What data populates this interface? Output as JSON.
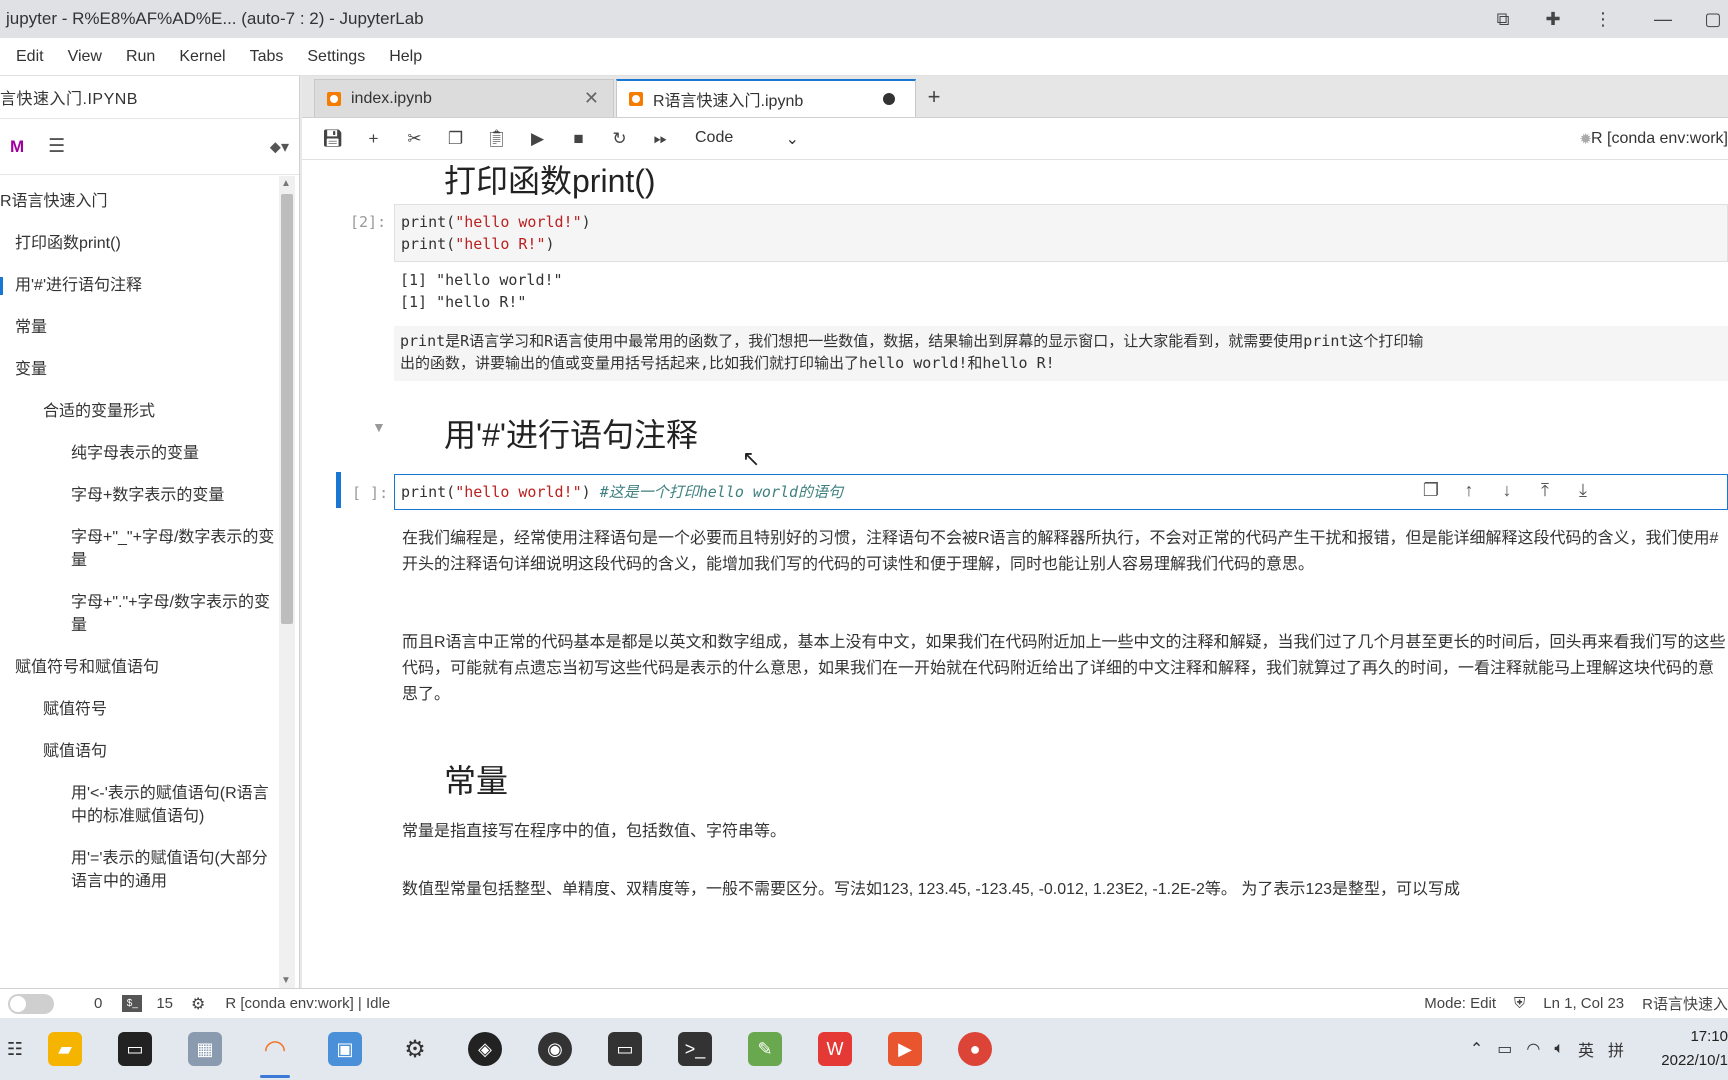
{
  "window": {
    "title": "jupyter - R%E8%AF%AD%E... (auto-7 : 2) - JupyterLab"
  },
  "menu": [
    "Edit",
    "View",
    "Run",
    "Kernel",
    "Tabs",
    "Settings",
    "Help"
  ],
  "sidebar": {
    "header": "言快速入门.IPYNB",
    "toc": [
      {
        "label": "R语言快速入门",
        "level": 1
      },
      {
        "label": "打印函数print()",
        "level": 2
      },
      {
        "label": "用'#'进行语句注释",
        "level": 2,
        "active": true
      },
      {
        "label": "常量",
        "level": 2
      },
      {
        "label": "变量",
        "level": 2
      },
      {
        "label": "合适的变量形式",
        "level": 3
      },
      {
        "label": "纯字母表示的变量",
        "level": 4
      },
      {
        "label": "字母+数字表示的变量",
        "level": 4
      },
      {
        "label": "字母+\"_\"+字母/数字表示的变量",
        "level": 4
      },
      {
        "label": "字母+\".\"+字母/数字表示的变量",
        "level": 4
      },
      {
        "label": "赋值符号和赋值语句",
        "level": 2
      },
      {
        "label": "赋值符号",
        "level": 3
      },
      {
        "label": "赋值语句",
        "level": 3
      },
      {
        "label": "用'<-'表示的赋值语句(R语言中的标准赋值语句)",
        "level": 4
      },
      {
        "label": "用'='表示的赋值语句(大部分语言中的通用",
        "level": 4
      }
    ]
  },
  "tabs": [
    {
      "label": "index.ipynb",
      "active": false
    },
    {
      "label": "R语言快速入门.ipynb",
      "active": true
    }
  ],
  "toolbar": {
    "cell_type": "Code",
    "kernel": "R [conda env:work]"
  },
  "notebook": {
    "heading1": "打印函数print()",
    "cell1_prompt": "[2]:",
    "cell1_line1_fn": "print(",
    "cell1_line1_str": "\"hello world!\"",
    "cell1_line2_str": "\"hello R!\"",
    "cell1_close": ")",
    "output1_line1": "[1] \"hello world!\"",
    "output1_line2": "[1] \"hello R!\"",
    "md1_line1": "print是R语言学习和R语言使用中最常用的函数了，我们想把一些数值，数据，结果输出到屏幕的显示窗口，让大家能看到，就需要使用print这个打印输",
    "md1_line2": "出的函数，讲要输出的值或变量用括号括起来,比如我们就打印输出了hello world!和hello R!",
    "heading2": "用'#'进行语句注释",
    "cell2_prompt": "[ ]:",
    "cell2_fn": "print(",
    "cell2_str": "\"hello world!\"",
    "cell2_close": ") ",
    "cell2_comment": "#这是一个打印hello world的语句",
    "para1": "在我们编程是，经常使用注释语句是一个必要而且特别好的习惯，注释语句不会被R语言的解释器所执行，不会对正常的代码产生干扰和报错，但是能详细解释这段代码的含义，我们使用#开头的注释语句详细说明这段代码的含义，能增加我们写的代码的可读性和便于理解，同时也能让别人容易理解我们代码的意思。",
    "para2": "而且R语言中正常的代码基本是都是以英文和数字组成，基本上没有中文，如果我们在代码附近加上一些中文的注释和解疑，当我们过了几个月甚至更长的时间后，回头再来看我们写的这些代码，可能就有点遗忘当初写这些代码是表示的什么意思，如果我们在一开始就在代码附近给出了详细的中文注释和解释，我们就算过了再久的时间，一看注释就能马上理解这块代码的意思了。",
    "heading3": "常量",
    "para3": "常量是指直接写在程序中的值，包括数值、字符串等。",
    "para4": "数值型常量包括整型、单精度、双精度等，一般不需要区分。写法如123, 123.45, -123.45, -0.012, 1.23E2, -1.2E-2等。 为了表示123是整型，可以写成"
  },
  "status": {
    "count1": "0",
    "count2": "15",
    "kernel_status": "R [conda env:work] | Idle",
    "mode": "Mode: Edit",
    "position": "Ln 1, Col 23",
    "file": "R语言快速入"
  },
  "taskbar": {
    "time": "17:10",
    "date": "2022/10/1",
    "ime1": "英",
    "ime2": "拼"
  },
  "colors": {
    "accent": "#1976d2",
    "string": "#ba2121",
    "comment": "#408080"
  }
}
